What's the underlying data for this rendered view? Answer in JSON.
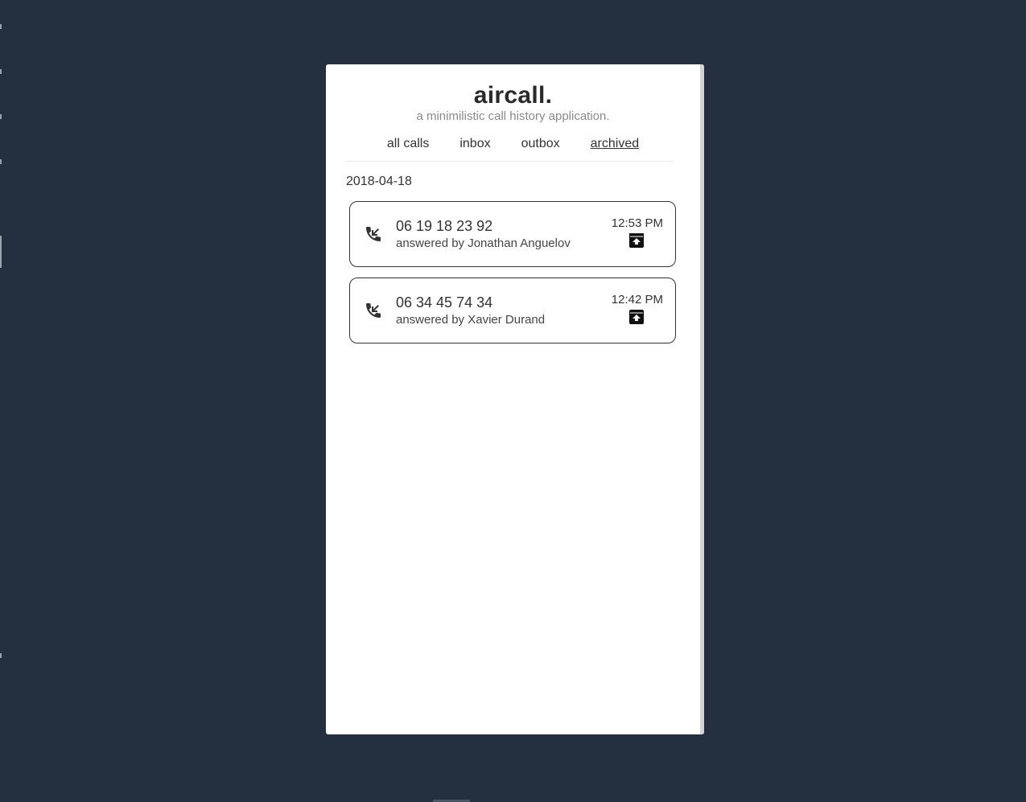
{
  "app": {
    "brand": "aircall.",
    "tagline": "a minimilistic call history application."
  },
  "nav": {
    "tabs": [
      {
        "label": "all calls",
        "active": false
      },
      {
        "label": "inbox",
        "active": false
      },
      {
        "label": "outbox",
        "active": false
      },
      {
        "label": "archived",
        "active": true
      }
    ]
  },
  "groups": [
    {
      "date": "2018-04-18",
      "calls": [
        {
          "number": "06 19 18 23 92",
          "detail": "answered by Jonathan Anguelov",
          "time": "12:53 PM",
          "direction_icon": "incoming-call-icon",
          "action_icon": "unarchive-icon"
        },
        {
          "number": "06 34 45 74 34",
          "detail": "answered by Xavier Durand",
          "time": "12:42 PM",
          "direction_icon": "incoming-call-icon",
          "action_icon": "unarchive-icon"
        }
      ]
    }
  ],
  "colors": {
    "background": "#243040",
    "card_border": "#333333",
    "text": "#333333",
    "muted": "#8a8a8a"
  }
}
